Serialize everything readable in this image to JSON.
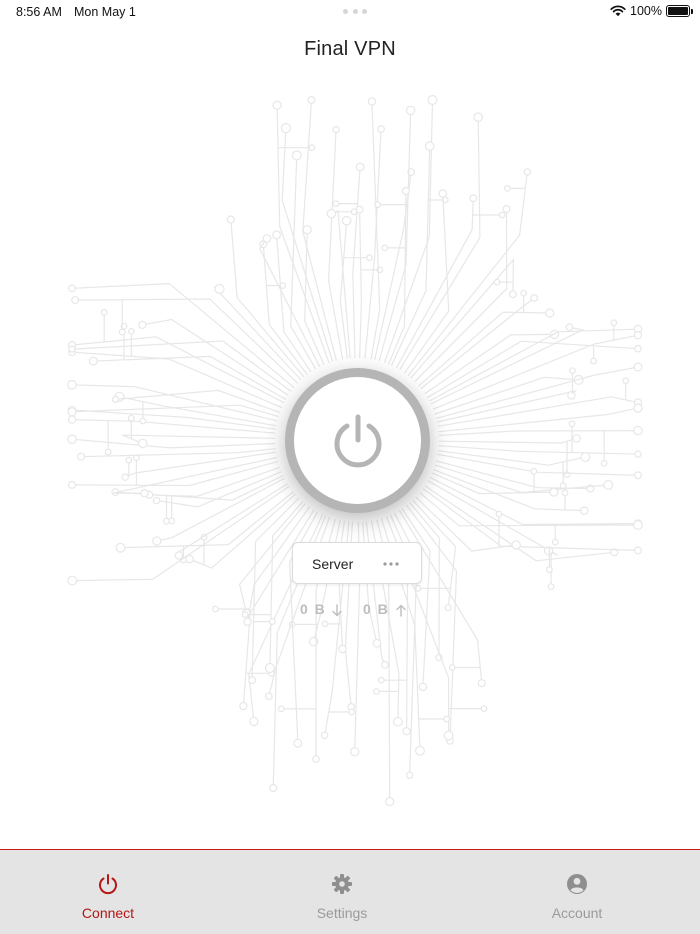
{
  "status_bar": {
    "time": "8:56 AM",
    "date": "Mon May 1",
    "battery_text": "100%"
  },
  "app": {
    "title": "Final VPN"
  },
  "connect": {
    "power_icon": "power-icon",
    "state": "disconnected"
  },
  "server": {
    "label": "Server",
    "more_icon": "ellipsis-icon"
  },
  "traffic": {
    "download": "0 B",
    "upload": "0 B"
  },
  "tabs": [
    {
      "label": "Connect",
      "icon": "power-icon",
      "active": true
    },
    {
      "label": "Settings",
      "icon": "gear-icon",
      "active": false
    },
    {
      "label": "Account",
      "icon": "person-circle-icon",
      "active": false
    }
  ],
  "colors": {
    "accent": "#b51616",
    "inactive": "#9a9a9a",
    "tab_bar_bg": "#e4e4e4",
    "power_ring": "#b5b5b5"
  }
}
